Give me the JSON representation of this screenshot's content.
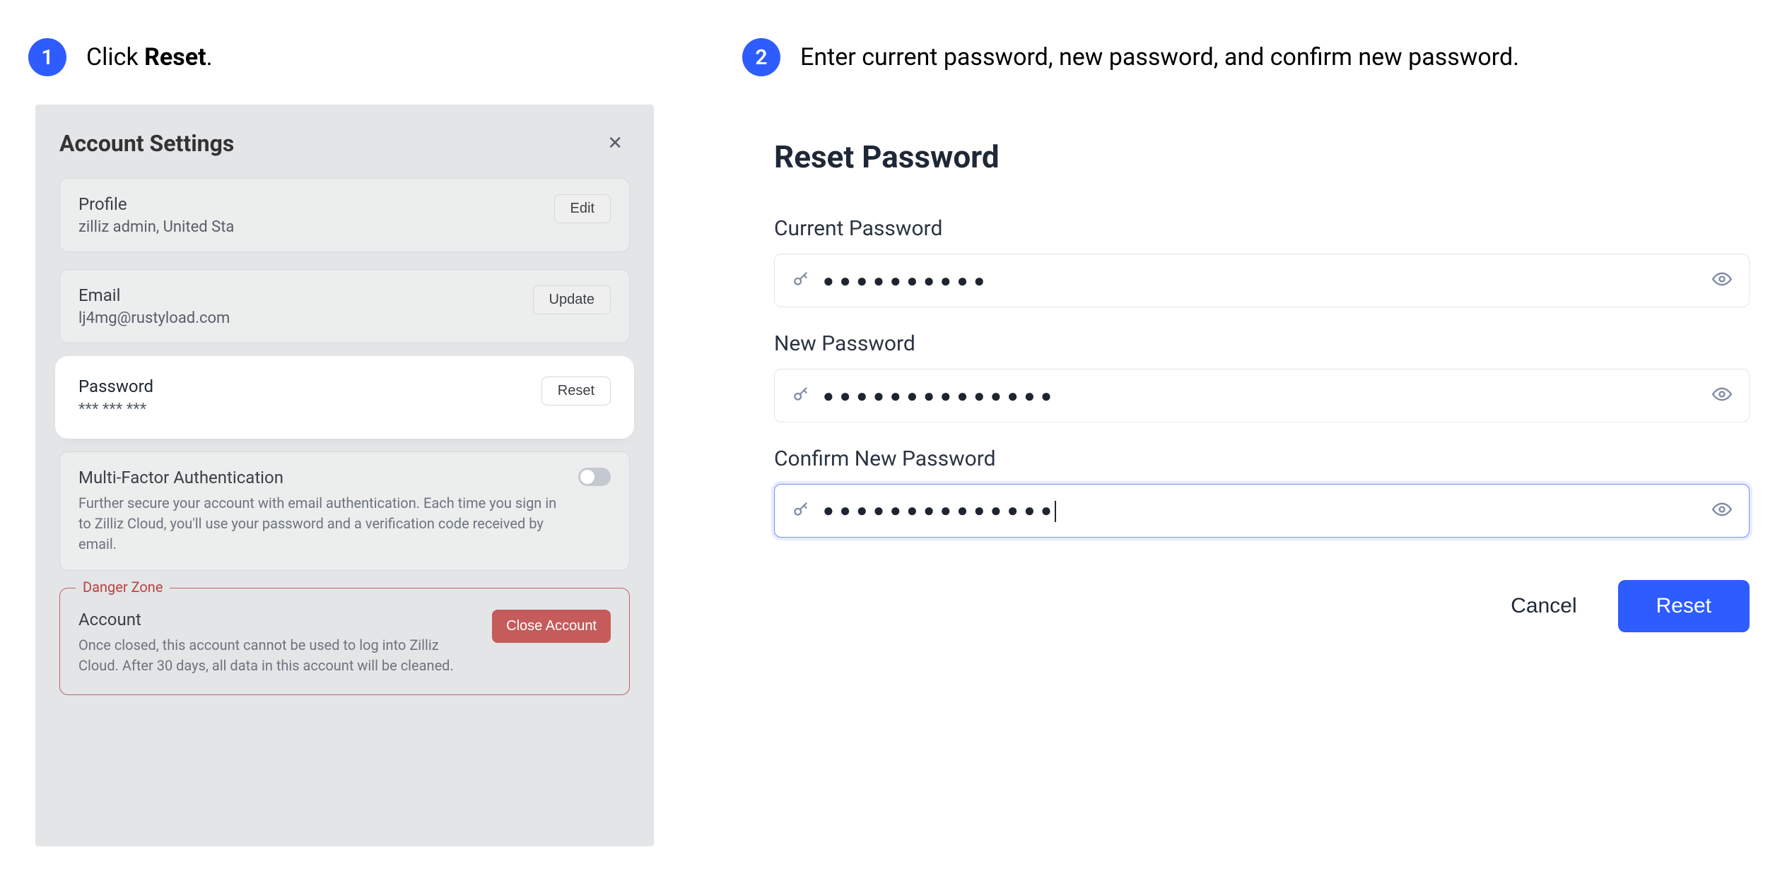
{
  "steps": {
    "one": {
      "number": "1",
      "caption_pre": "Click ",
      "caption_bold": "Reset",
      "caption_post": "."
    },
    "two": {
      "number": "2",
      "caption": "Enter current password, new password, and confirm new password."
    }
  },
  "left": {
    "title": "Account Settings",
    "profile": {
      "heading": "Profile",
      "sub": "zilliz admin, United Sta",
      "button": "Edit"
    },
    "email": {
      "heading": "Email",
      "sub": "lj4mg@rustyload.com",
      "button": "Update"
    },
    "password": {
      "heading": "Password",
      "sub": "*** *** ***",
      "button": "Reset"
    },
    "mfa": {
      "heading": "Multi-Factor Authentication",
      "desc": "Further secure your account with email authentication. Each time you sign in to Zilliz Cloud, you'll use your password and a verification code received by email."
    },
    "danger": {
      "legend": "Danger Zone",
      "heading": "Account",
      "desc": "Once closed, this account cannot be used to log into Zilliz Cloud. After 30 days, all data in this account will be cleaned.",
      "button": "Close Account"
    }
  },
  "right": {
    "title": "Reset Password",
    "current_label": "Current Password",
    "new_label": "New Password",
    "confirm_label": "Confirm New Password",
    "current_value": "●●●●●●●●●●",
    "new_value": "●●●●●●●●●●●●●●",
    "confirm_value": "●●●●●●●●●●●●●●",
    "cancel": "Cancel",
    "reset": "Reset"
  }
}
